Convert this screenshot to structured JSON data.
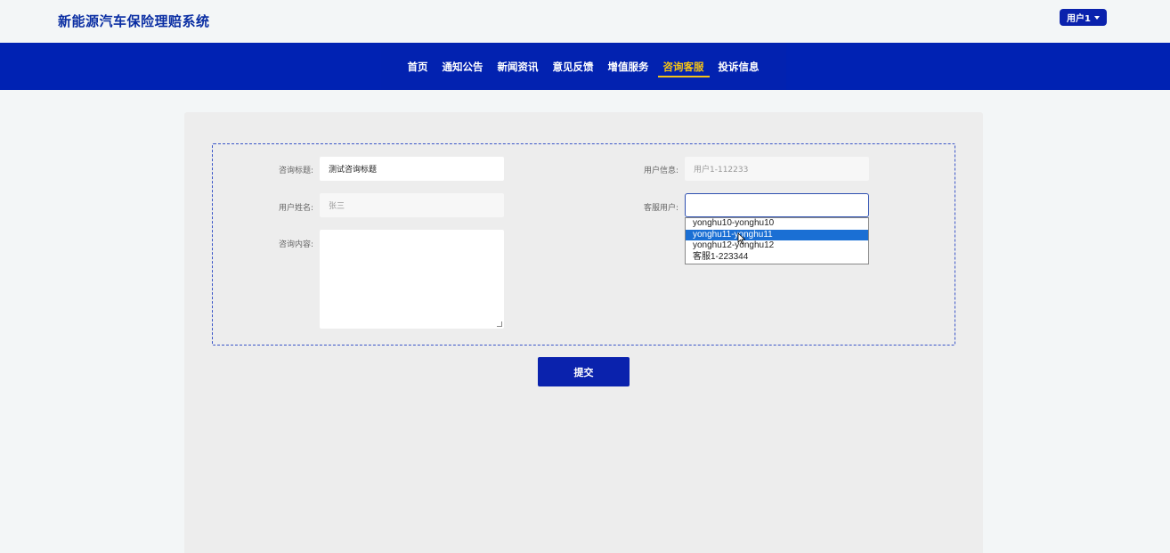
{
  "header": {
    "site_title": "新能源汽车保险理赔系统",
    "user_menu_label": "用户1"
  },
  "nav": {
    "items": [
      {
        "label": "首页",
        "active": false
      },
      {
        "label": "通知公告",
        "active": false
      },
      {
        "label": "新闻资讯",
        "active": false
      },
      {
        "label": "意见反馈",
        "active": false
      },
      {
        "label": "增值服务",
        "active": false
      },
      {
        "label": "咨询客服",
        "active": true
      },
      {
        "label": "投诉信息",
        "active": false
      }
    ]
  },
  "form": {
    "title_label": "咨询标题:",
    "title_value": "测试咨询标题",
    "user_info_label": "用户信息:",
    "user_info_value": "用户1-112233",
    "user_name_label": "用户姓名:",
    "user_name_value": "张三",
    "service_user_label": "客服用户:",
    "service_user_value": "",
    "content_label": "咨询内容:",
    "content_value": "",
    "service_user_options": [
      "yonghu10-yonghu10",
      "yonghu11-yonghu11",
      "yonghu12-yonghu12",
      "客服1-223344"
    ],
    "highlighted_option_index": 1,
    "submit_label": "提交"
  },
  "colors": {
    "primary": "#0a22ad",
    "nav_bg": "#0022b3",
    "active_nav": "#f4c316",
    "highlight": "#1a6fd4"
  }
}
